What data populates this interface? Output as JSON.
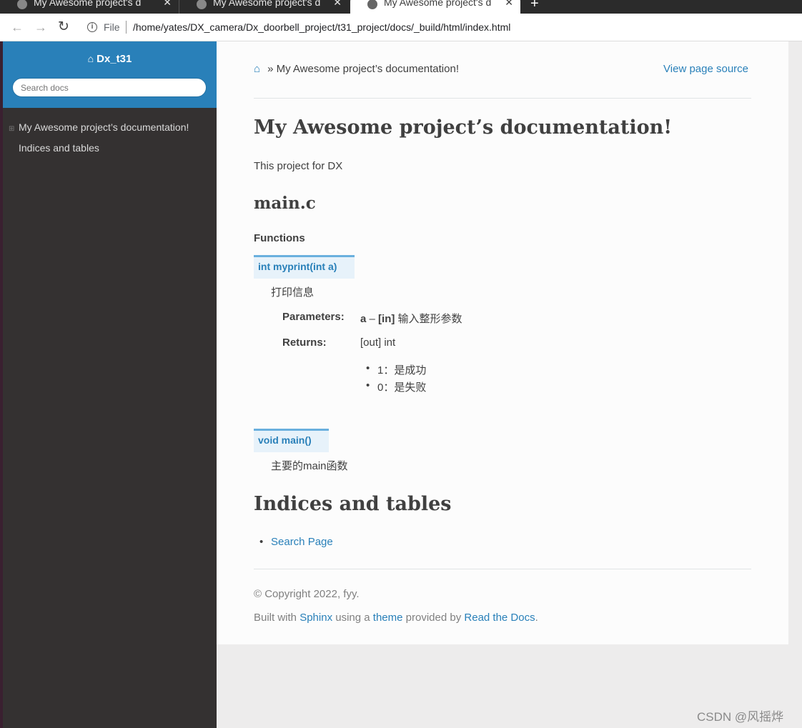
{
  "browser": {
    "tabs": [
      {
        "title": "My Awesome project's do",
        "close": "✕"
      },
      {
        "title": "My Awesome project's do",
        "close": "✕"
      },
      {
        "title": "My Awesome project's do",
        "close": "✕"
      }
    ],
    "new_tab": "+",
    "address": {
      "scheme": "File",
      "url": "/home/yates/DX_camera/Dx_doorbell_project/t31_project/docs/_build/html/index.html"
    }
  },
  "sidebar": {
    "project_name": "Dx_t31",
    "search_placeholder": "Search docs",
    "toc": [
      {
        "label": "My Awesome project’s documentation!",
        "expander": "⊞"
      },
      {
        "label": "Indices and tables"
      }
    ]
  },
  "content": {
    "breadcrumb_sep": "»",
    "breadcrumb_current": "My Awesome project’s documentation!",
    "view_source": "View page source",
    "title": "My Awesome project’s documentation!",
    "intro": "This project for DX",
    "section_main": "main.c",
    "functions_label": "Functions",
    "functions": [
      {
        "signature": "int myprint(int a)",
        "description": "打印信息",
        "params_label": "Parameters:",
        "param_name": "a",
        "param_dash": " – ",
        "param_tag": "[in]",
        "param_desc": " 输入整形参数",
        "returns_label": "Returns:",
        "returns_value": "[out] int",
        "returns_list": [
          "1：是成功",
          "0：是失败"
        ]
      },
      {
        "signature": "void main()",
        "description": "主要的main函数"
      }
    ],
    "section_indices": "Indices and tables",
    "indices_links": [
      "Search Page"
    ],
    "footer": {
      "copyright": "© Copyright 2022, fyy.",
      "built_prefix": "Built with ",
      "sphinx": "Sphinx",
      "using": " using a ",
      "theme": "theme",
      "provided": " provided by ",
      "rtd": "Read the Docs",
      "period": "."
    }
  },
  "watermark": "CSDN @风摇烨",
  "colors": {
    "accent": "#2980b9",
    "sidebar_bg": "#343131",
    "signature_bg": "#e7f2fa",
    "signature_border": "#6ab0de"
  }
}
